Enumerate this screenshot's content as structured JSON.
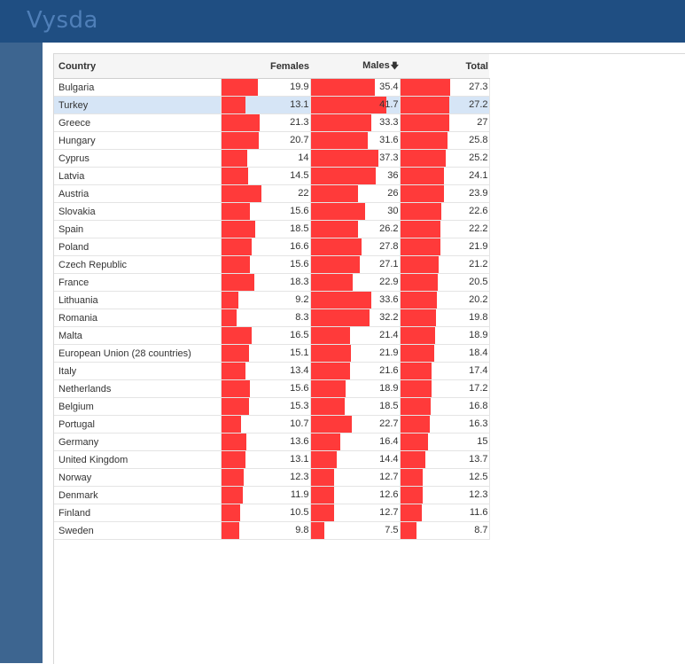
{
  "app": {
    "logo_text": "Vysda"
  },
  "colors": {
    "topbar": "#1f4e82",
    "sidebar": "#3d6590",
    "bar": "#ff3a3a",
    "selected_row": "#d6e5f6"
  },
  "table": {
    "columns": [
      {
        "key": "country",
        "label": "Country"
      },
      {
        "key": "females",
        "label": "Females"
      },
      {
        "key": "males",
        "label": "Males",
        "sort_icon": "🡇"
      },
      {
        "key": "total",
        "label": "Total"
      }
    ],
    "max": {
      "females": 41.7,
      "males": 41.7,
      "total": 41.7
    },
    "selected_row": 1,
    "rows": [
      {
        "country": "Bulgaria",
        "females": "19.9",
        "males": "35.4",
        "total": "27.3"
      },
      {
        "country": "Turkey",
        "females": "13.1",
        "males": "41.7",
        "total": "27.2"
      },
      {
        "country": "Greece",
        "females": "21.3",
        "males": "33.3",
        "total": "27"
      },
      {
        "country": "Hungary",
        "females": "20.7",
        "males": "31.6",
        "total": "25.8"
      },
      {
        "country": "Cyprus",
        "females": "14",
        "males": "37.3",
        "total": "25.2"
      },
      {
        "country": "Latvia",
        "females": "14.5",
        "males": "36",
        "total": "24.1"
      },
      {
        "country": "Austria",
        "females": "22",
        "males": "26",
        "total": "23.9"
      },
      {
        "country": "Slovakia",
        "females": "15.6",
        "males": "30",
        "total": "22.6"
      },
      {
        "country": "Spain",
        "females": "18.5",
        "males": "26.2",
        "total": "22.2"
      },
      {
        "country": "Poland",
        "females": "16.6",
        "males": "27.8",
        "total": "21.9"
      },
      {
        "country": "Czech Republic",
        "females": "15.6",
        "males": "27.1",
        "total": "21.2"
      },
      {
        "country": "France",
        "females": "18.3",
        "males": "22.9",
        "total": "20.5"
      },
      {
        "country": "Lithuania",
        "females": "9.2",
        "males": "33.6",
        "total": "20.2"
      },
      {
        "country": "Romania",
        "females": "8.3",
        "males": "32.2",
        "total": "19.8"
      },
      {
        "country": "Malta",
        "females": "16.5",
        "males": "21.4",
        "total": "18.9"
      },
      {
        "country": "European Union (28 countries)",
        "females": "15.1",
        "males": "21.9",
        "total": "18.4"
      },
      {
        "country": "Italy",
        "females": "13.4",
        "males": "21.6",
        "total": "17.4"
      },
      {
        "country": "Netherlands",
        "females": "15.6",
        "males": "18.9",
        "total": "17.2"
      },
      {
        "country": "Belgium",
        "females": "15.3",
        "males": "18.5",
        "total": "16.8"
      },
      {
        "country": "Portugal",
        "females": "10.7",
        "males": "22.7",
        "total": "16.3"
      },
      {
        "country": "Germany",
        "females": "13.6",
        "males": "16.4",
        "total": "15"
      },
      {
        "country": "United Kingdom",
        "females": "13.1",
        "males": "14.4",
        "total": "13.7"
      },
      {
        "country": "Norway",
        "females": "12.3",
        "males": "12.7",
        "total": "12.5"
      },
      {
        "country": "Denmark",
        "females": "11.9",
        "males": "12.6",
        "total": "12.3"
      },
      {
        "country": "Finland",
        "females": "10.5",
        "males": "12.7",
        "total": "11.6"
      },
      {
        "country": "Sweden",
        "females": "9.8",
        "males": "7.5",
        "total": "8.7"
      }
    ]
  }
}
